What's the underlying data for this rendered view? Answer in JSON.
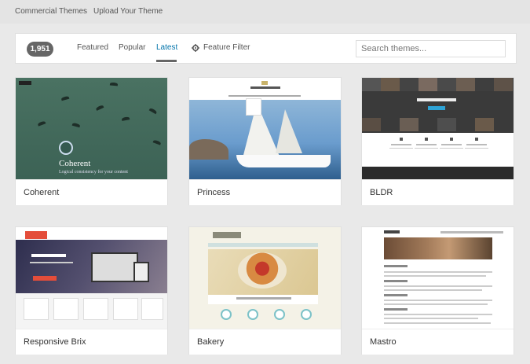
{
  "top_nav": {
    "commercial": "Commercial Themes",
    "upload": "Upload Your Theme"
  },
  "filter_bar": {
    "count": "1,951",
    "tabs": [
      "Featured",
      "Popular",
      "Latest"
    ],
    "active_tab": "Latest",
    "feature_filter": "Feature Filter",
    "search_placeholder": "Search themes..."
  },
  "themes": [
    {
      "name": "Coherent",
      "preview_title": "Coherent",
      "preview_tagline": "Logical consistency for your content"
    },
    {
      "name": "Princess"
    },
    {
      "name": "BLDR"
    },
    {
      "name": "Responsive Brix"
    },
    {
      "name": "Bakery"
    },
    {
      "name": "Mastro"
    }
  ],
  "colors": {
    "accent": "#0073aa",
    "count_badge": "#666666",
    "background": "#e9e9e9"
  }
}
